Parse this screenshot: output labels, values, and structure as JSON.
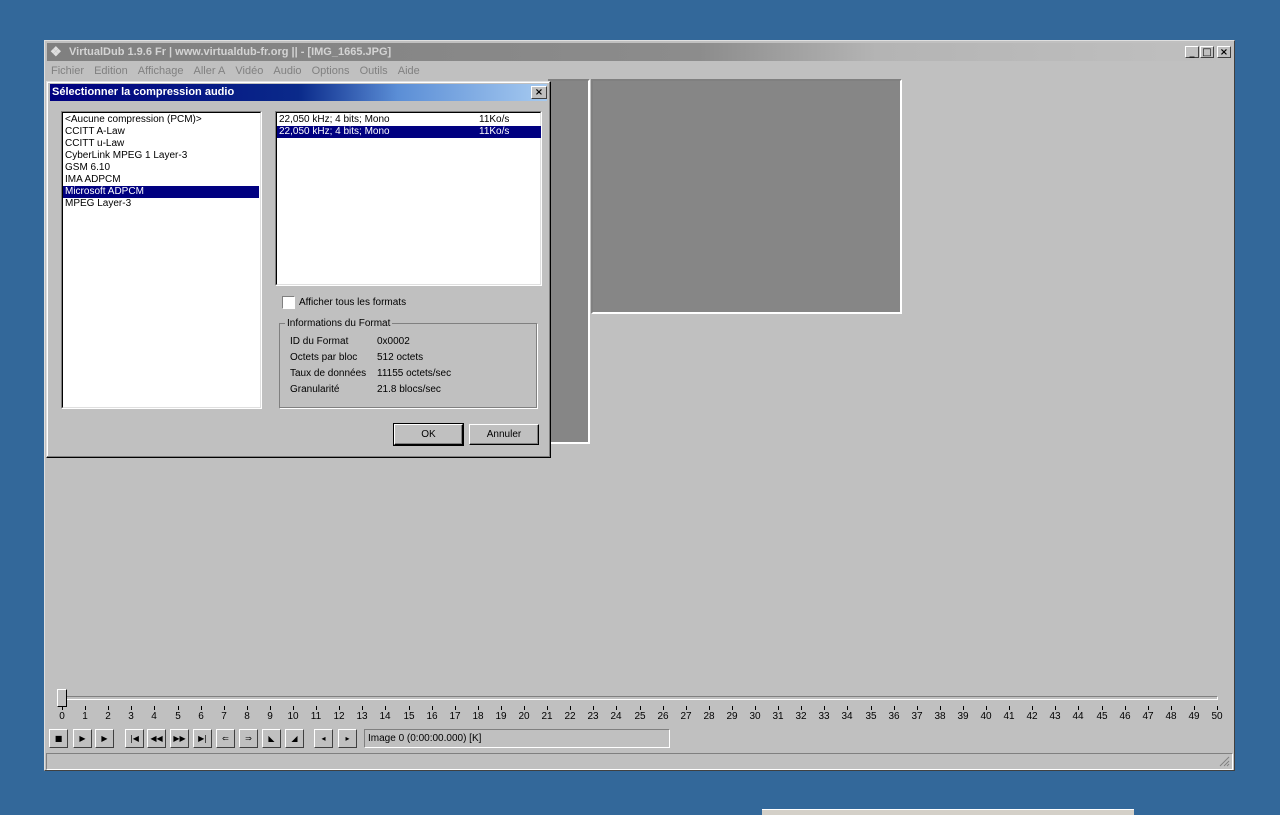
{
  "main_window": {
    "title": "VirtualDub 1.9.6 Fr | www.virtualdub-fr.org || - [IMG_1665.JPG]",
    "menu": [
      "Fichier",
      "Edition",
      "Affichage",
      "Aller A",
      "Vidéo",
      "Audio",
      "Options",
      "Outils",
      "Aide"
    ],
    "caption_buttons": {
      "minimize": "_",
      "maximize": "□",
      "close": "×"
    }
  },
  "dialog": {
    "title": "Sélectionner la compression audio",
    "close_glyph": "×",
    "codecs": [
      "<Aucune compression (PCM)>",
      "CCITT A-Law",
      "CCITT u-Law",
      "CyberLink MPEG 1 Layer-3",
      "GSM 6.10",
      "IMA ADPCM",
      "Microsoft ADPCM",
      "MPEG Layer-3"
    ],
    "selected_codec_index": 6,
    "formats": [
      {
        "format": "22,050 kHz; 4 bits; Mono",
        "rate": "11Ko/s"
      },
      {
        "format": "22,050 kHz; 4 bits; Mono",
        "rate": "11Ko/s"
      }
    ],
    "selected_format_index": 1,
    "show_all_label": "Afficher tous les formats",
    "show_all_checked": false,
    "info": {
      "legend": "Informations du Format",
      "rows": [
        {
          "label": "ID du Format",
          "value": "0x0002"
        },
        {
          "label": "Octets par bloc",
          "value": "512 octets"
        },
        {
          "label": "Taux de données",
          "value": "11155 octets/sec"
        },
        {
          "label": "Granularité",
          "value": "21.8 blocs/sec"
        }
      ]
    },
    "ok_label": "OK",
    "cancel_label": "Annuler"
  },
  "timeline": {
    "tick_labels": [
      "0",
      "1",
      "2",
      "3",
      "4",
      "5",
      "6",
      "7",
      "8",
      "9",
      "10",
      "11",
      "12",
      "13",
      "14",
      "15",
      "16",
      "17",
      "18",
      "19",
      "20",
      "21",
      "22",
      "23",
      "24",
      "25",
      "26",
      "27",
      "28",
      "29",
      "30",
      "31",
      "32",
      "33",
      "34",
      "35",
      "36",
      "37",
      "38",
      "39",
      "40",
      "41",
      "42",
      "43",
      "44",
      "45",
      "46",
      "47",
      "48",
      "49",
      "50"
    ],
    "current_position": 0,
    "frame_readout": "Image 0 (0:00:00.000) [K]",
    "toolbar_icons": [
      "stop-icon",
      "play-input-icon",
      "play-output-icon",
      "go-start-icon",
      "prev-key-icon",
      "next-key-icon",
      "go-end-icon",
      "scene-prev-icon",
      "scene-next-icon",
      "mark-in-icon",
      "mark-out-icon",
      "prev-frame-icon",
      "next-frame-icon"
    ],
    "toolbar_glyphs": [
      "■",
      "▶",
      "▶",
      "|◀",
      "◀◀",
      "▶▶",
      "▶|",
      "⇐",
      "⇒",
      "◣",
      "◢",
      "◂",
      "▸"
    ]
  }
}
